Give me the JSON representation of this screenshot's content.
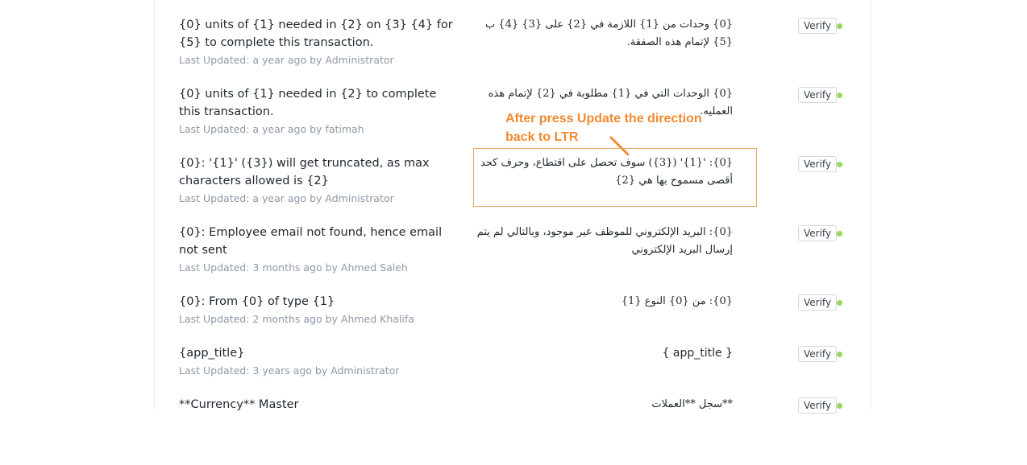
{
  "rows": [
    {
      "source": "{0} units of {1} needed in {2} on {3} {4} for {5} to complete this transaction.",
      "meta": "Last Updated: a year ago by Administrator",
      "translation": "{0} وحدات من {1} اللازمة في {2} على {3} {4} ب {5} لإتمام هذه الصفقة.",
      "verify": "Verify"
    },
    {
      "source": "{0} units of {1} needed in {2} to complete this transaction.",
      "meta": "Last Updated: a year ago by fatimah",
      "translation": "{0} الوحدات التي في {1} مطلوبة في {2} لإتمام هذه العمليه.",
      "verify": "Verify"
    },
    {
      "source": "{0}: '{1}' ({3}) will get truncated, as max characters allowed is {2}",
      "meta": "Last Updated: a year ago by Administrator",
      "translation": "{0}: '{1}' ({3}) سوف تحصل على اقتطاع، وحرف كحد أقصى مسموح بها هي {2}",
      "verify": "Verify"
    },
    {
      "source": "{0}: Employee email not found, hence email not sent",
      "meta": "Last Updated: 3 months ago by Ahmed Saleh",
      "translation": "{0}: البريد الإلكتروني للموظف غير موجود، وبالتالي لم يتم إرسال البريد الإلكتروني",
      "verify": "Verify"
    },
    {
      "source": "{0}: From {0} of type {1}",
      "meta": "Last Updated: 2 months ago by Ahmed Khalifa",
      "translation": "{0}: من {0} النوع {1}",
      "verify": "Verify"
    },
    {
      "source": "{app_title}",
      "meta": "Last Updated: 3 years ago by Administrator",
      "translation": "{ app_title }",
      "verify": "Verify"
    },
    {
      "source": "**Currency** Master",
      "meta": "",
      "translation": "**سجل **العملات",
      "verify": "Verify"
    }
  ],
  "annotation": {
    "line1": "After press Update the direction",
    "line2": "back to LTR",
    "color": "#f28a30"
  },
  "colors": {
    "status_dot": "#98d85b",
    "meta_text": "#8d99a6",
    "body_text": "#1f272e"
  }
}
